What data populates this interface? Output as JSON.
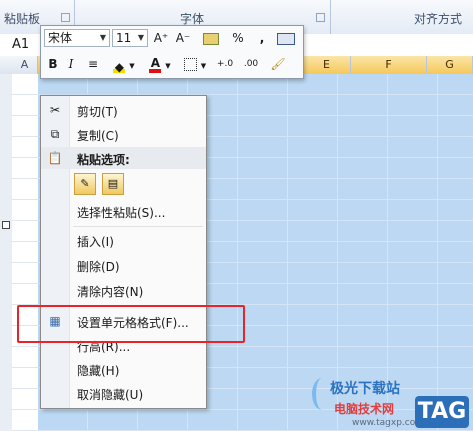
{
  "ribbon": {
    "group_clipboard": "粘贴板",
    "group_font": "字体",
    "group_alignment": "对齐方式"
  },
  "formula_bar": {
    "name_box": "A1"
  },
  "column_headers": [
    "A",
    "E",
    "F",
    "G"
  ],
  "mini_toolbar": {
    "font_name": "宋体",
    "font_size": "11",
    "grow_font": "A⁺",
    "shrink_font": "A⁻",
    "percent": "%",
    "comma": ",",
    "bold": "B",
    "italic": "I",
    "increase_decimal": "+.0",
    "decrease_decimal": ".00"
  },
  "context_menu": {
    "cut": "剪切(T)",
    "copy": "复制(C)",
    "paste_options": "粘贴选项:",
    "paste_special": "选择性粘贴(S)...",
    "insert": "插入(I)",
    "delete": "删除(D)",
    "clear_contents": "清除内容(N)",
    "format_cells": "设置单元格格式(F)...",
    "row_height": "行高(R)...",
    "hide": "隐藏(H)",
    "unhide": "取消隐藏(U)"
  },
  "watermark": {
    "line1": "极光下载站",
    "line2": "电脑技术网",
    "url": "www.tagxp.com",
    "tag": "TAG"
  },
  "colors": {
    "selection_fill": "#bcd8f2",
    "highlight_border": "#e8242a",
    "ribbon_bg": "#e4ebf5"
  }
}
